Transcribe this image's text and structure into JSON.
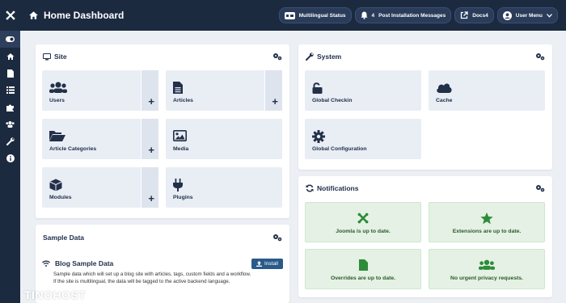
{
  "header": {
    "title": "Home Dashboard",
    "buttons": {
      "multilingual": "Multilingual Status",
      "post_install_count": "4",
      "post_install": "Post Installation Messages",
      "docs": "Docs4",
      "user_menu": "User Menu"
    }
  },
  "site": {
    "title": "Site",
    "tiles": {
      "users": "Users",
      "articles": "Articles",
      "categories": "Article Categories",
      "media": "Media",
      "modules": "Modules",
      "plugins": "Plugins"
    }
  },
  "system": {
    "title": "System",
    "tiles": {
      "checkin": "Global Checkin",
      "cache": "Cache",
      "config": "Global Configuration"
    }
  },
  "notifications": {
    "title": "Notifications",
    "tiles": {
      "joomla": "Joomla is up to date.",
      "extensions": "Extensions are up to date.",
      "overrides": "Overrides are up to date.",
      "privacy": "No urgent privacy requests."
    }
  },
  "sample_data": {
    "title": "Sample Data",
    "blog_title": "Blog Sample Data",
    "install_label": "Install",
    "line1": "Sample data which will set up a blog site with articles, tags, custom fields and a workflow.",
    "line2": "If the site is multilingual, the data will be tagged to the active backend language."
  },
  "watermark": "TINOHOST",
  "colors": {
    "sidebar": "#1c2a40",
    "tile": "#e9eef5",
    "notify": "#e4f1e4",
    "accent": "#2a5a8a"
  }
}
